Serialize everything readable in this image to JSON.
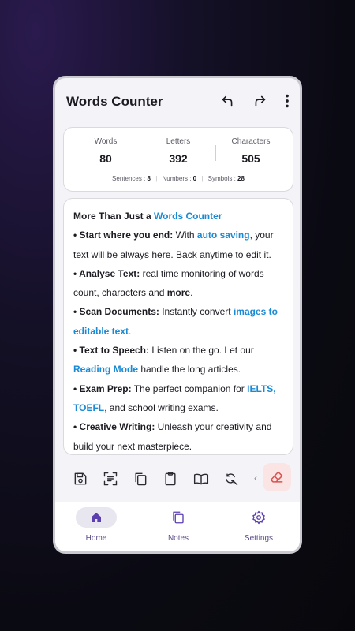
{
  "app": {
    "title": "Words Counter"
  },
  "stats": {
    "words_label": "Words",
    "words_value": "80",
    "letters_label": "Letters",
    "letters_value": "392",
    "characters_label": "Characters",
    "characters_value": "505",
    "sentences_label": "Sentences :",
    "sentences_value": "8",
    "numbers_label": "Numbers :",
    "numbers_value": "0",
    "symbols_label": "Symbols :",
    "symbols_value": "28"
  },
  "editor": {
    "heading_prefix": "More Than Just a ",
    "heading_highlight": "Words Counter",
    "items": [
      {
        "label": "• Start where you end:",
        "t1": " With ",
        "h1": "auto saving",
        "t2": ", your text will be always here. Back anytime to edit it."
      },
      {
        "label": "• Analyse Text:",
        "t1": " real time monitoring of words count, characters and ",
        "b1": "more",
        "t2": "."
      },
      {
        "label": "• Scan Documents:",
        "t1": " Instantly convert ",
        "h1": "images to editable text",
        "t2": "."
      },
      {
        "label": "• Text to Speech:",
        "t1": " Listen on the go. Let our ",
        "h1": "Reading Mode",
        "t2": " handle the long articles."
      },
      {
        "label": "• Exam Prep:",
        "t1": " The perfect companion for ",
        "h1": "IELTS, TOEFL",
        "t2": ", and school writing exams."
      },
      {
        "label": "• Creative Writing:",
        "t1": " Unleash your creativity and build your next masterpiece."
      }
    ]
  },
  "nav": {
    "home": "Home",
    "notes": "Notes",
    "settings": "Settings"
  },
  "colors": {
    "accent": "#5b3fb0",
    "highlight": "#1a8ad4",
    "eraser_bg": "#fbe4e4",
    "eraser": "#d9534f"
  }
}
